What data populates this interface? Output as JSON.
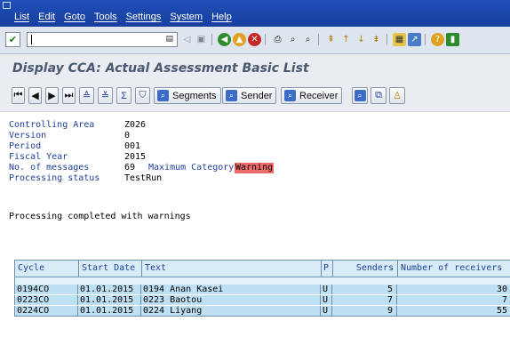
{
  "menu": [
    "List",
    "Edit",
    "Goto",
    "Tools",
    "Settings",
    "System",
    "Help"
  ],
  "toolbar": {
    "command_value": ""
  },
  "page_title": "Display CCA: Actual Assessment Basic List",
  "app_toolbar": {
    "segments": "Segments",
    "sender": "Sender",
    "receiver": "Receiver"
  },
  "header": {
    "controlling_area_label": "Controlling Area",
    "controlling_area": "Z026",
    "version_label": "Version",
    "version": "0",
    "period_label": "Period",
    "period": "001",
    "fiscal_year_label": "Fiscal Year",
    "fiscal_year": "2015",
    "messages_label": "No. of messages",
    "messages": "69",
    "max_category_label": "Maximum Category",
    "max_category": "Warning",
    "status_label": "Processing status",
    "status": "TestRun",
    "result": "Processing completed with warnings"
  },
  "table": {
    "columns": [
      "Cycle",
      "Start Date",
      "Text",
      "P",
      "Senders",
      "Number of receivers"
    ],
    "rows": [
      [
        "0194CO",
        "01.01.2015",
        "0194 Anan Kasei",
        "U",
        "5",
        "30"
      ],
      [
        "0223CO",
        "01.01.2015",
        "0223 Baotou",
        "U",
        "7",
        "7"
      ],
      [
        "0224CO",
        "01.01.2015",
        "0224 Liyang",
        "U",
        "9",
        "55"
      ]
    ]
  },
  "colors": {
    "menubar": "#1f4fb8",
    "warning": "#f06b6b",
    "row": "#bfe0f2"
  }
}
